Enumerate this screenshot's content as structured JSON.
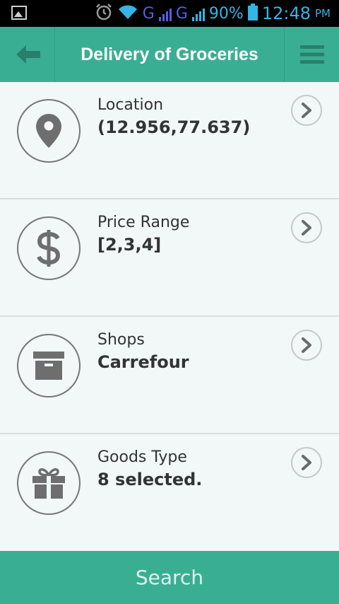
{
  "status_bar": {
    "network_1": "G",
    "network_2": "G",
    "battery": "90%",
    "time": "12:48",
    "ampm": "PM",
    "icons": [
      "image-icon",
      "alarm-icon",
      "wifi-icon",
      "signal-icon",
      "signal-icon",
      "battery-icon"
    ]
  },
  "header": {
    "title": "Delivery of Groceries",
    "back_icon": "arrow-left-icon",
    "menu_icon": "hamburger-menu-icon",
    "color": "#3aae93"
  },
  "filters": [
    {
      "label": "Location",
      "value": "(12.956,77.637)",
      "icon": "map-pin-icon"
    },
    {
      "label": "Price Range",
      "value": "[2,3,4]",
      "icon": "dollar-icon"
    },
    {
      "label": "Shops",
      "value": "Carrefour",
      "icon": "archive-box-icon"
    },
    {
      "label": "Goods Type",
      "value": "8 selected.",
      "icon": "gift-icon"
    }
  ],
  "search_button": {
    "label": "Search"
  }
}
